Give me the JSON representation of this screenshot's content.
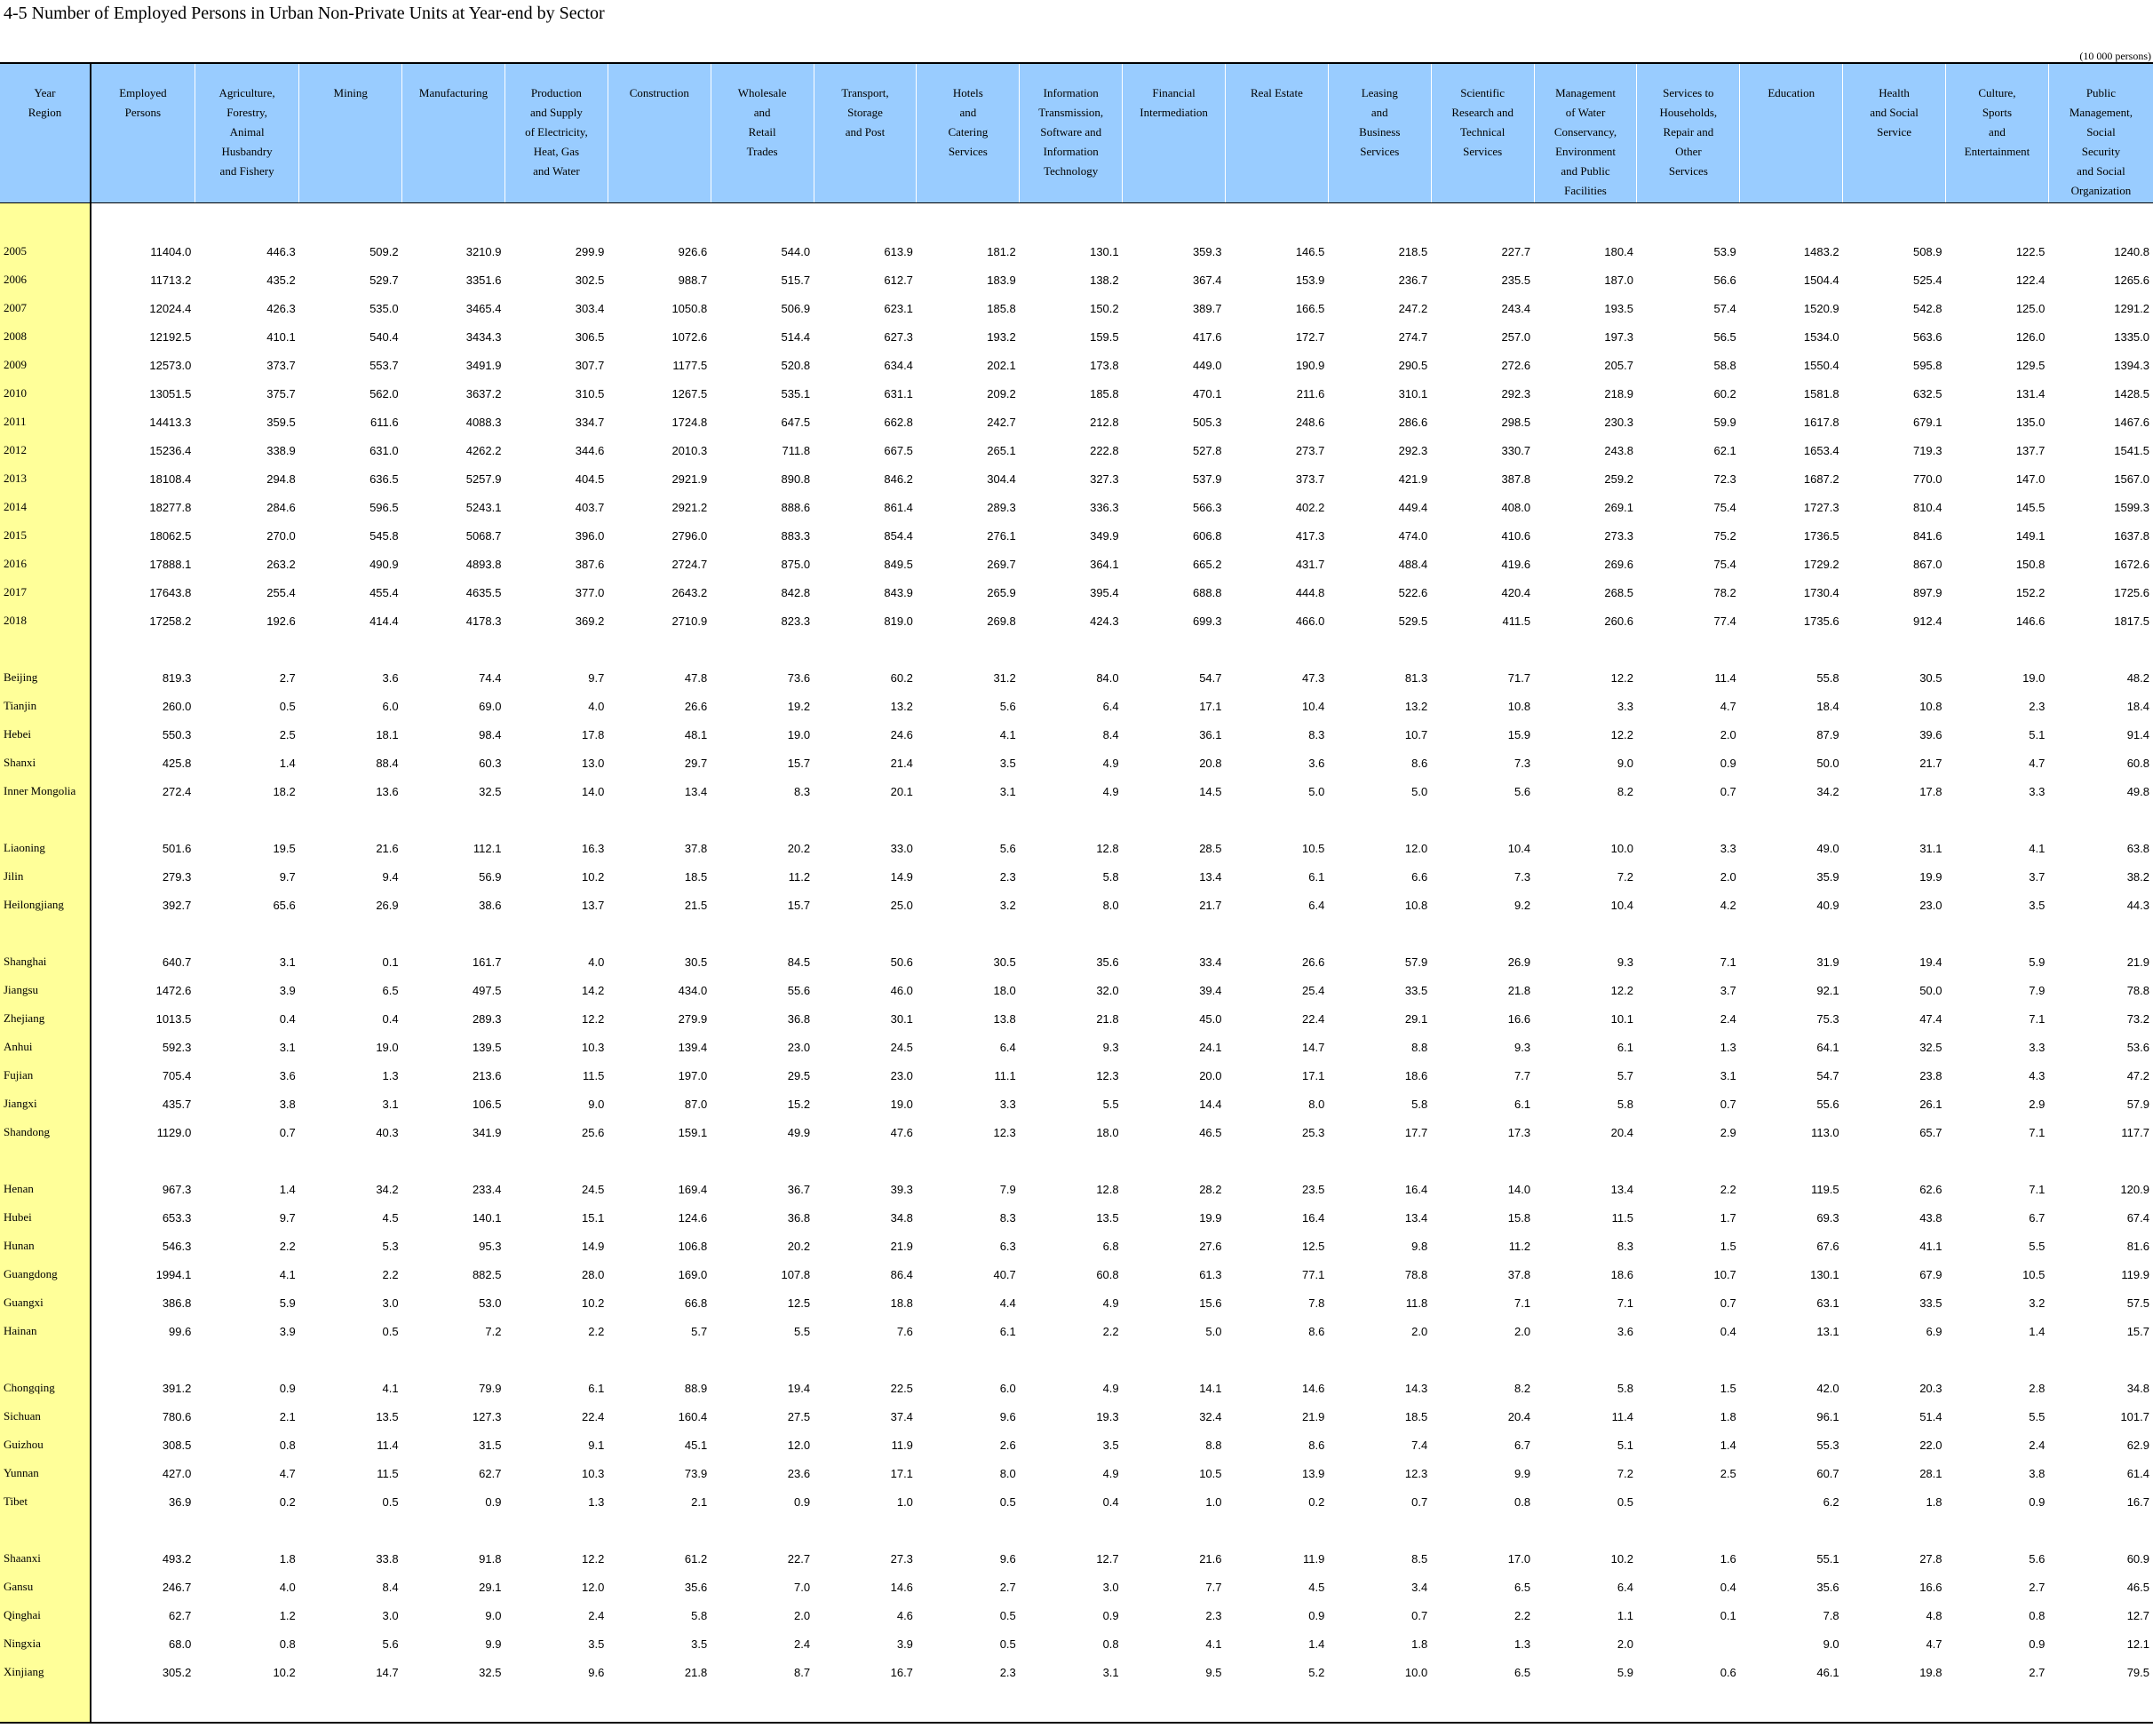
{
  "title": "4-5  Number of Employed Persons in Urban Non-Private Units at Year-end by Sector",
  "unit": "(10 000 persons)",
  "columns": [
    "Year\nRegion",
    "Employed\nPersons",
    "Agriculture,\nForestry,\nAnimal\nHusbandry\nand Fishery",
    "Mining",
    "Manufacturing",
    "Production\nand Supply\nof Electricity,\nHeat, Gas\nand Water",
    "Construction",
    "Wholesale\nand\nRetail\nTrades",
    "Transport,\nStorage\nand Post",
    "Hotels\nand\nCatering\nServices",
    "Information\nTransmission,\nSoftware and\nInformation\nTechnology",
    "Financial\nIntermediation",
    "Real Estate",
    "Leasing\nand\nBusiness\nServices",
    "Scientific\nResearch and\nTechnical\nServices",
    "Management\nof Water\nConservancy,\nEnvironment\nand Public\nFacilities",
    "Services to\nHouseholds,\nRepair and\nOther\nServices",
    "Education",
    "Health\nand Social\nService",
    "Culture,\nSports\nand\nEntertainment",
    "Public\nManagement,\nSocial\nSecurity\nand Social\nOrganization"
  ],
  "groups": [
    [
      [
        "2005",
        "11404.0",
        "446.3",
        "509.2",
        "3210.9",
        "299.9",
        "926.6",
        "544.0",
        "613.9",
        "181.2",
        "130.1",
        "359.3",
        "146.5",
        "218.5",
        "227.7",
        "180.4",
        "53.9",
        "1483.2",
        "508.9",
        "122.5",
        "1240.8"
      ],
      [
        "2006",
        "11713.2",
        "435.2",
        "529.7",
        "3351.6",
        "302.5",
        "988.7",
        "515.7",
        "612.7",
        "183.9",
        "138.2",
        "367.4",
        "153.9",
        "236.7",
        "235.5",
        "187.0",
        "56.6",
        "1504.4",
        "525.4",
        "122.4",
        "1265.6"
      ],
      [
        "2007",
        "12024.4",
        "426.3",
        "535.0",
        "3465.4",
        "303.4",
        "1050.8",
        "506.9",
        "623.1",
        "185.8",
        "150.2",
        "389.7",
        "166.5",
        "247.2",
        "243.4",
        "193.5",
        "57.4",
        "1520.9",
        "542.8",
        "125.0",
        "1291.2"
      ],
      [
        "2008",
        "12192.5",
        "410.1",
        "540.4",
        "3434.3",
        "306.5",
        "1072.6",
        "514.4",
        "627.3",
        "193.2",
        "159.5",
        "417.6",
        "172.7",
        "274.7",
        "257.0",
        "197.3",
        "56.5",
        "1534.0",
        "563.6",
        "126.0",
        "1335.0"
      ],
      [
        "2009",
        "12573.0",
        "373.7",
        "553.7",
        "3491.9",
        "307.7",
        "1177.5",
        "520.8",
        "634.4",
        "202.1",
        "173.8",
        "449.0",
        "190.9",
        "290.5",
        "272.6",
        "205.7",
        "58.8",
        "1550.4",
        "595.8",
        "129.5",
        "1394.3"
      ],
      [
        "2010",
        "13051.5",
        "375.7",
        "562.0",
        "3637.2",
        "310.5",
        "1267.5",
        "535.1",
        "631.1",
        "209.2",
        "185.8",
        "470.1",
        "211.6",
        "310.1",
        "292.3",
        "218.9",
        "60.2",
        "1581.8",
        "632.5",
        "131.4",
        "1428.5"
      ],
      [
        "2011",
        "14413.3",
        "359.5",
        "611.6",
        "4088.3",
        "334.7",
        "1724.8",
        "647.5",
        "662.8",
        "242.7",
        "212.8",
        "505.3",
        "248.6",
        "286.6",
        "298.5",
        "230.3",
        "59.9",
        "1617.8",
        "679.1",
        "135.0",
        "1467.6"
      ],
      [
        "2012",
        "15236.4",
        "338.9",
        "631.0",
        "4262.2",
        "344.6",
        "2010.3",
        "711.8",
        "667.5",
        "265.1",
        "222.8",
        "527.8",
        "273.7",
        "292.3",
        "330.7",
        "243.8",
        "62.1",
        "1653.4",
        "719.3",
        "137.7",
        "1541.5"
      ],
      [
        "2013",
        "18108.4",
        "294.8",
        "636.5",
        "5257.9",
        "404.5",
        "2921.9",
        "890.8",
        "846.2",
        "304.4",
        "327.3",
        "537.9",
        "373.7",
        "421.9",
        "387.8",
        "259.2",
        "72.3",
        "1687.2",
        "770.0",
        "147.0",
        "1567.0"
      ],
      [
        "2014",
        "18277.8",
        "284.6",
        "596.5",
        "5243.1",
        "403.7",
        "2921.2",
        "888.6",
        "861.4",
        "289.3",
        "336.3",
        "566.3",
        "402.2",
        "449.4",
        "408.0",
        "269.1",
        "75.4",
        "1727.3",
        "810.4",
        "145.5",
        "1599.3"
      ],
      [
        "2015",
        "18062.5",
        "270.0",
        "545.8",
        "5068.7",
        "396.0",
        "2796.0",
        "883.3",
        "854.4",
        "276.1",
        "349.9",
        "606.8",
        "417.3",
        "474.0",
        "410.6",
        "273.3",
        "75.2",
        "1736.5",
        "841.6",
        "149.1",
        "1637.8"
      ],
      [
        "2016",
        "17888.1",
        "263.2",
        "490.9",
        "4893.8",
        "387.6",
        "2724.7",
        "875.0",
        "849.5",
        "269.7",
        "364.1",
        "665.2",
        "431.7",
        "488.4",
        "419.6",
        "269.6",
        "75.4",
        "1729.2",
        "867.0",
        "150.8",
        "1672.6"
      ],
      [
        "2017",
        "17643.8",
        "255.4",
        "455.4",
        "4635.5",
        "377.0",
        "2643.2",
        "842.8",
        "843.9",
        "265.9",
        "395.4",
        "688.8",
        "444.8",
        "522.6",
        "420.4",
        "268.5",
        "78.2",
        "1730.4",
        "897.9",
        "152.2",
        "1725.6"
      ],
      [
        "2018",
        "17258.2",
        "192.6",
        "414.4",
        "4178.3",
        "369.2",
        "2710.9",
        "823.3",
        "819.0",
        "269.8",
        "424.3",
        "699.3",
        "466.0",
        "529.5",
        "411.5",
        "260.6",
        "77.4",
        "1735.6",
        "912.4",
        "146.6",
        "1817.5"
      ]
    ],
    [
      [
        "Beijing",
        "819.3",
        "2.7",
        "3.6",
        "74.4",
        "9.7",
        "47.8",
        "73.6",
        "60.2",
        "31.2",
        "84.0",
        "54.7",
        "47.3",
        "81.3",
        "71.7",
        "12.2",
        "11.4",
        "55.8",
        "30.5",
        "19.0",
        "48.2"
      ],
      [
        "Tianjin",
        "260.0",
        "0.5",
        "6.0",
        "69.0",
        "4.0",
        "26.6",
        "19.2",
        "13.2",
        "5.6",
        "6.4",
        "17.1",
        "10.4",
        "13.2",
        "10.8",
        "3.3",
        "4.7",
        "18.4",
        "10.8",
        "2.3",
        "18.4"
      ],
      [
        "Hebei",
        "550.3",
        "2.5",
        "18.1",
        "98.4",
        "17.8",
        "48.1",
        "19.0",
        "24.6",
        "4.1",
        "8.4",
        "36.1",
        "8.3",
        "10.7",
        "15.9",
        "12.2",
        "2.0",
        "87.9",
        "39.6",
        "5.1",
        "91.4"
      ],
      [
        "Shanxi",
        "425.8",
        "1.4",
        "88.4",
        "60.3",
        "13.0",
        "29.7",
        "15.7",
        "21.4",
        "3.5",
        "4.9",
        "20.8",
        "3.6",
        "8.6",
        "7.3",
        "9.0",
        "0.9",
        "50.0",
        "21.7",
        "4.7",
        "60.8"
      ],
      [
        "Inner Mongolia",
        "272.4",
        "18.2",
        "13.6",
        "32.5",
        "14.0",
        "13.4",
        "8.3",
        "20.1",
        "3.1",
        "4.9",
        "14.5",
        "5.0",
        "5.0",
        "5.6",
        "8.2",
        "0.7",
        "34.2",
        "17.8",
        "3.3",
        "49.8"
      ]
    ],
    [
      [
        "Liaoning",
        "501.6",
        "19.5",
        "21.6",
        "112.1",
        "16.3",
        "37.8",
        "20.2",
        "33.0",
        "5.6",
        "12.8",
        "28.5",
        "10.5",
        "12.0",
        "10.4",
        "10.0",
        "3.3",
        "49.0",
        "31.1",
        "4.1",
        "63.8"
      ],
      [
        "Jilin",
        "279.3",
        "9.7",
        "9.4",
        "56.9",
        "10.2",
        "18.5",
        "11.2",
        "14.9",
        "2.3",
        "5.8",
        "13.4",
        "6.1",
        "6.6",
        "7.3",
        "7.2",
        "2.0",
        "35.9",
        "19.9",
        "3.7",
        "38.2"
      ],
      [
        "Heilongjiang",
        "392.7",
        "65.6",
        "26.9",
        "38.6",
        "13.7",
        "21.5",
        "15.7",
        "25.0",
        "3.2",
        "8.0",
        "21.7",
        "6.4",
        "10.8",
        "9.2",
        "10.4",
        "4.2",
        "40.9",
        "23.0",
        "3.5",
        "44.3"
      ]
    ],
    [
      [
        "Shanghai",
        "640.7",
        "3.1",
        "0.1",
        "161.7",
        "4.0",
        "30.5",
        "84.5",
        "50.6",
        "30.5",
        "35.6",
        "33.4",
        "26.6",
        "57.9",
        "26.9",
        "9.3",
        "7.1",
        "31.9",
        "19.4",
        "5.9",
        "21.9"
      ],
      [
        "Jiangsu",
        "1472.6",
        "3.9",
        "6.5",
        "497.5",
        "14.2",
        "434.0",
        "55.6",
        "46.0",
        "18.0",
        "32.0",
        "39.4",
        "25.4",
        "33.5",
        "21.8",
        "12.2",
        "3.7",
        "92.1",
        "50.0",
        "7.9",
        "78.8"
      ],
      [
        "Zhejiang",
        "1013.5",
        "0.4",
        "0.4",
        "289.3",
        "12.2",
        "279.9",
        "36.8",
        "30.1",
        "13.8",
        "21.8",
        "45.0",
        "22.4",
        "29.1",
        "16.6",
        "10.1",
        "2.4",
        "75.3",
        "47.4",
        "7.1",
        "73.2"
      ],
      [
        "Anhui",
        "592.3",
        "3.1",
        "19.0",
        "139.5",
        "10.3",
        "139.4",
        "23.0",
        "24.5",
        "6.4",
        "9.3",
        "24.1",
        "14.7",
        "8.8",
        "9.3",
        "6.1",
        "1.3",
        "64.1",
        "32.5",
        "3.3",
        "53.6"
      ],
      [
        "Fujian",
        "705.4",
        "3.6",
        "1.3",
        "213.6",
        "11.5",
        "197.0",
        "29.5",
        "23.0",
        "11.1",
        "12.3",
        "20.0",
        "17.1",
        "18.6",
        "7.7",
        "5.7",
        "3.1",
        "54.7",
        "23.8",
        "4.3",
        "47.2"
      ],
      [
        "Jiangxi",
        "435.7",
        "3.8",
        "3.1",
        "106.5",
        "9.0",
        "87.0",
        "15.2",
        "19.0",
        "3.3",
        "5.5",
        "14.4",
        "8.0",
        "5.8",
        "6.1",
        "5.8",
        "0.7",
        "55.6",
        "26.1",
        "2.9",
        "57.9"
      ],
      [
        "Shandong",
        "1129.0",
        "0.7",
        "40.3",
        "341.9",
        "25.6",
        "159.1",
        "49.9",
        "47.6",
        "12.3",
        "18.0",
        "46.5",
        "25.3",
        "17.7",
        "17.3",
        "20.4",
        "2.9",
        "113.0",
        "65.7",
        "7.1",
        "117.7"
      ]
    ],
    [
      [
        "Henan",
        "967.3",
        "1.4",
        "34.2",
        "233.4",
        "24.5",
        "169.4",
        "36.7",
        "39.3",
        "7.9",
        "12.8",
        "28.2",
        "23.5",
        "16.4",
        "14.0",
        "13.4",
        "2.2",
        "119.5",
        "62.6",
        "7.1",
        "120.9"
      ],
      [
        "Hubei",
        "653.3",
        "9.7",
        "4.5",
        "140.1",
        "15.1",
        "124.6",
        "36.8",
        "34.8",
        "8.3",
        "13.5",
        "19.9",
        "16.4",
        "13.4",
        "15.8",
        "11.5",
        "1.7",
        "69.3",
        "43.8",
        "6.7",
        "67.4"
      ],
      [
        "Hunan",
        "546.3",
        "2.2",
        "5.3",
        "95.3",
        "14.9",
        "106.8",
        "20.2",
        "21.9",
        "6.3",
        "6.8",
        "27.6",
        "12.5",
        "9.8",
        "11.2",
        "8.3",
        "1.5",
        "67.6",
        "41.1",
        "5.5",
        "81.6"
      ],
      [
        "Guangdong",
        "1994.1",
        "4.1",
        "2.2",
        "882.5",
        "28.0",
        "169.0",
        "107.8",
        "86.4",
        "40.7",
        "60.8",
        "61.3",
        "77.1",
        "78.8",
        "37.8",
        "18.6",
        "10.7",
        "130.1",
        "67.9",
        "10.5",
        "119.9"
      ],
      [
        "Guangxi",
        "386.8",
        "5.9",
        "3.0",
        "53.0",
        "10.2",
        "66.8",
        "12.5",
        "18.8",
        "4.4",
        "4.9",
        "15.6",
        "7.8",
        "11.8",
        "7.1",
        "7.1",
        "0.7",
        "63.1",
        "33.5",
        "3.2",
        "57.5"
      ],
      [
        "Hainan",
        "99.6",
        "3.9",
        "0.5",
        "7.2",
        "2.2",
        "5.7",
        "5.5",
        "7.6",
        "6.1",
        "2.2",
        "5.0",
        "8.6",
        "2.0",
        "2.0",
        "3.6",
        "0.4",
        "13.1",
        "6.9",
        "1.4",
        "15.7"
      ]
    ],
    [
      [
        "Chongqing",
        "391.2",
        "0.9",
        "4.1",
        "79.9",
        "6.1",
        "88.9",
        "19.4",
        "22.5",
        "6.0",
        "4.9",
        "14.1",
        "14.6",
        "14.3",
        "8.2",
        "5.8",
        "1.5",
        "42.0",
        "20.3",
        "2.8",
        "34.8"
      ],
      [
        "Sichuan",
        "780.6",
        "2.1",
        "13.5",
        "127.3",
        "22.4",
        "160.4",
        "27.5",
        "37.4",
        "9.6",
        "19.3",
        "32.4",
        "21.9",
        "18.5",
        "20.4",
        "11.4",
        "1.8",
        "96.1",
        "51.4",
        "5.5",
        "101.7"
      ],
      [
        "Guizhou",
        "308.5",
        "0.8",
        "11.4",
        "31.5",
        "9.1",
        "45.1",
        "12.0",
        "11.9",
        "2.6",
        "3.5",
        "8.8",
        "8.6",
        "7.4",
        "6.7",
        "5.1",
        "1.4",
        "55.3",
        "22.0",
        "2.4",
        "62.9"
      ],
      [
        "Yunnan",
        "427.0",
        "4.7",
        "11.5",
        "62.7",
        "10.3",
        "73.9",
        "23.6",
        "17.1",
        "8.0",
        "4.9",
        "10.5",
        "13.9",
        "12.3",
        "9.9",
        "7.2",
        "2.5",
        "60.7",
        "28.1",
        "3.8",
        "61.4"
      ],
      [
        "Tibet",
        "36.9",
        "0.2",
        "0.5",
        "0.9",
        "1.3",
        "2.1",
        "0.9",
        "1.0",
        "0.5",
        "0.4",
        "1.0",
        "0.2",
        "0.7",
        "0.8",
        "0.5",
        "",
        "6.2",
        "1.8",
        "0.9",
        "16.7"
      ]
    ],
    [
      [
        "Shaanxi",
        "493.2",
        "1.8",
        "33.8",
        "91.8",
        "12.2",
        "61.2",
        "22.7",
        "27.3",
        "9.6",
        "12.7",
        "21.6",
        "11.9",
        "8.5",
        "17.0",
        "10.2",
        "1.6",
        "55.1",
        "27.8",
        "5.6",
        "60.9"
      ],
      [
        "Gansu",
        "246.7",
        "4.0",
        "8.4",
        "29.1",
        "12.0",
        "35.6",
        "7.0",
        "14.6",
        "2.7",
        "3.0",
        "7.7",
        "4.5",
        "3.4",
        "6.5",
        "6.4",
        "0.4",
        "35.6",
        "16.6",
        "2.7",
        "46.5"
      ],
      [
        "Qinghai",
        "62.7",
        "1.2",
        "3.0",
        "9.0",
        "2.4",
        "5.8",
        "2.0",
        "4.6",
        "0.5",
        "0.9",
        "2.3",
        "0.9",
        "0.7",
        "2.2",
        "1.1",
        "0.1",
        "7.8",
        "4.8",
        "0.8",
        "12.7"
      ],
      [
        "Ningxia",
        "68.0",
        "0.8",
        "5.6",
        "9.9",
        "3.5",
        "3.5",
        "2.4",
        "3.9",
        "0.5",
        "0.8",
        "4.1",
        "1.4",
        "1.8",
        "1.3",
        "2.0",
        "",
        "9.0",
        "4.7",
        "0.9",
        "12.1"
      ],
      [
        "Xinjiang",
        "305.2",
        "10.2",
        "14.7",
        "32.5",
        "9.6",
        "21.8",
        "8.7",
        "16.7",
        "2.3",
        "3.1",
        "9.5",
        "5.2",
        "10.0",
        "6.5",
        "5.9",
        "0.6",
        "46.1",
        "19.8",
        "2.7",
        "79.5"
      ]
    ]
  ]
}
